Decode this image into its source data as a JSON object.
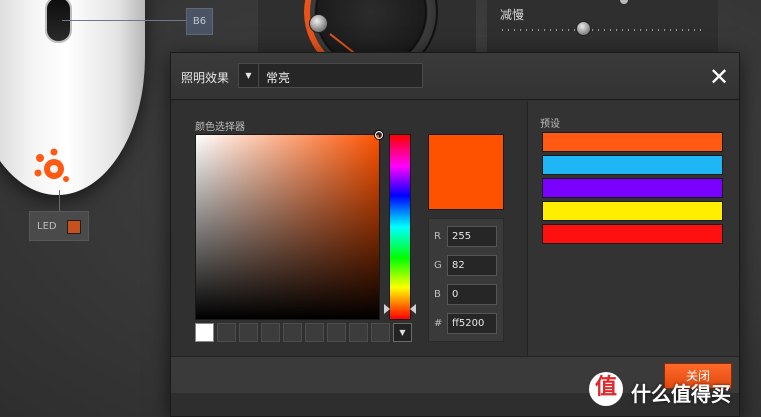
{
  "background": {
    "b6_badge": "B6",
    "led_label": "LED",
    "led_swatch_color": "#c8501c",
    "decel_label": "减慢"
  },
  "dialog": {
    "effect_label": "照明效果",
    "effect_value": "常亮",
    "close_symbol": "✕",
    "picker_title": "颜色选择器",
    "current_color": "#ff5200",
    "rgb": {
      "r_label": "R",
      "r_value": "255",
      "g_label": "G",
      "g_value": "82",
      "b_label": "B",
      "b_value": "0",
      "hex_label": "#",
      "hex_value": "ff5200"
    },
    "presets_title": "预设",
    "presets": [
      "#ff5a14",
      "#1fb6f5",
      "#7a00ff",
      "#ffee00",
      "#ff1010"
    ],
    "ok_label": "关闭"
  },
  "watermark": {
    "logo": "值",
    "text": "什么值得买"
  }
}
